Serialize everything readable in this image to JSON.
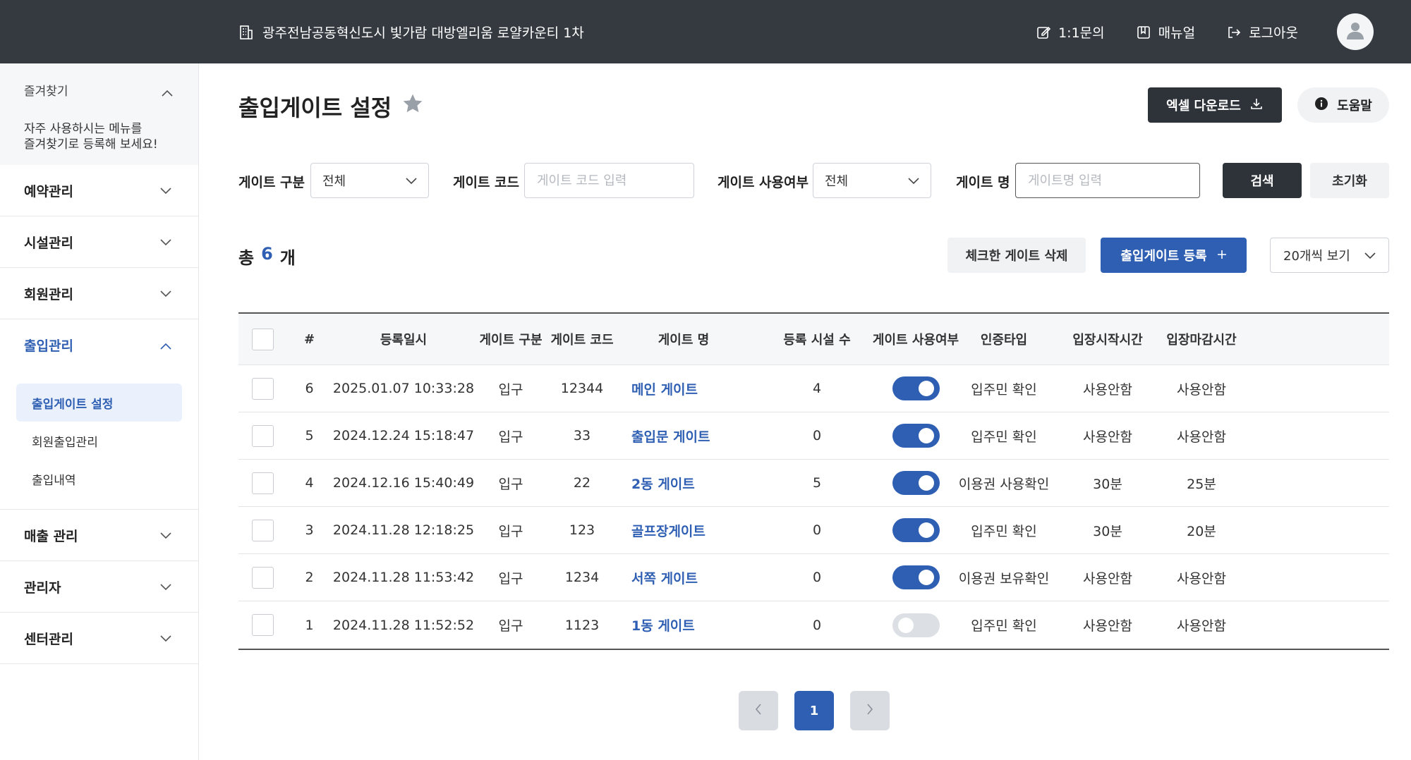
{
  "header": {
    "site_name": "광주전남공동혁신도시 빛가람 대방엘리움 로얄카운티 1차",
    "inquiry_label": "1:1문의",
    "manual_label": "매뉴얼",
    "logout_label": "로그아웃"
  },
  "sidebar": {
    "favorites_title": "즐겨찾기",
    "favorites_desc": "자주 사용하시는 메뉴를\n즐겨찾기로 등록해 보세요!",
    "items": [
      {
        "label": "예약관리"
      },
      {
        "label": "시설관리"
      },
      {
        "label": "회원관리"
      },
      {
        "label": "출입관리"
      },
      {
        "label": "매출 관리"
      },
      {
        "label": "관리자"
      },
      {
        "label": "센터관리"
      }
    ],
    "sub_items": [
      {
        "label": "출입게이트 설정"
      },
      {
        "label": "회원출입관리"
      },
      {
        "label": "출입내역"
      }
    ]
  },
  "page": {
    "title": "출입게이트 설정",
    "excel_label": "엑셀 다운로드",
    "help_label": "도움말"
  },
  "filters": {
    "gate_type_label": "게이트 구분",
    "gate_type_value": "전체",
    "gate_code_label": "게이트 코드",
    "gate_code_placeholder": "게이트 코드 입력",
    "gate_use_label": "게이트 사용여부",
    "gate_use_value": "전체",
    "gate_name_label": "게이트 명",
    "gate_name_placeholder": "게이트명 입력",
    "search_label": "검색",
    "reset_label": "초기화"
  },
  "list": {
    "total_prefix": "총",
    "total_count": "6",
    "total_suffix": "개",
    "delete_label": "체크한 게이트 삭제",
    "register_label": "출입게이트 등록",
    "per_page_label": "20개씩 보기"
  },
  "table": {
    "headers": [
      "#",
      "등록일시",
      "게이트 구분",
      "게이트 코드",
      "게이트 명",
      "등록 시설 수",
      "게이트 사용여부",
      "인증타입",
      "입장시작시간",
      "입장마감시간"
    ],
    "rows": [
      {
        "no": "6",
        "date": "2025.01.07 10:33:28",
        "type": "입구",
        "code": "12344",
        "name": "메인 게이트",
        "count": "4",
        "enabled": true,
        "auth": "입주민 확인",
        "start": "사용안함",
        "end": "사용안함"
      },
      {
        "no": "5",
        "date": "2024.12.24 15:18:47",
        "type": "입구",
        "code": "33",
        "name": "출입문 게이트",
        "count": "0",
        "enabled": true,
        "auth": "입주민 확인",
        "start": "사용안함",
        "end": "사용안함"
      },
      {
        "no": "4",
        "date": "2024.12.16 15:40:49",
        "type": "입구",
        "code": "22",
        "name": "2동 게이트",
        "count": "5",
        "enabled": true,
        "auth": "이용권 사용확인",
        "start": "30분",
        "end": "25분"
      },
      {
        "no": "3",
        "date": "2024.11.28 12:18:25",
        "type": "입구",
        "code": "123",
        "name": "골프장게이트",
        "count": "0",
        "enabled": true,
        "auth": "입주민 확인",
        "start": "30분",
        "end": "20분"
      },
      {
        "no": "2",
        "date": "2024.11.28 11:53:42",
        "type": "입구",
        "code": "1234",
        "name": "서쪽 게이트",
        "count": "0",
        "enabled": true,
        "auth": "이용권 보유확인",
        "start": "사용안함",
        "end": "사용안함"
      },
      {
        "no": "1",
        "date": "2024.11.28 11:52:52",
        "type": "입구",
        "code": "1123",
        "name": "1동 게이트",
        "count": "0",
        "enabled": false,
        "auth": "입주민 확인",
        "start": "사용안함",
        "end": "사용안함"
      }
    ]
  },
  "pagination": {
    "current": "1"
  },
  "colors": {
    "accent": "#2f5fb3",
    "header_bg": "#343a40",
    "dark_button": "#2e3339"
  },
  "icons": [
    "building-icon",
    "edit-icon",
    "book-icon",
    "logout-icon",
    "user-icon",
    "star-icon",
    "download-icon",
    "info-icon",
    "chevron-down-icon",
    "chevron-up-icon",
    "plus-icon",
    "chevron-left-icon",
    "chevron-right-icon"
  ]
}
